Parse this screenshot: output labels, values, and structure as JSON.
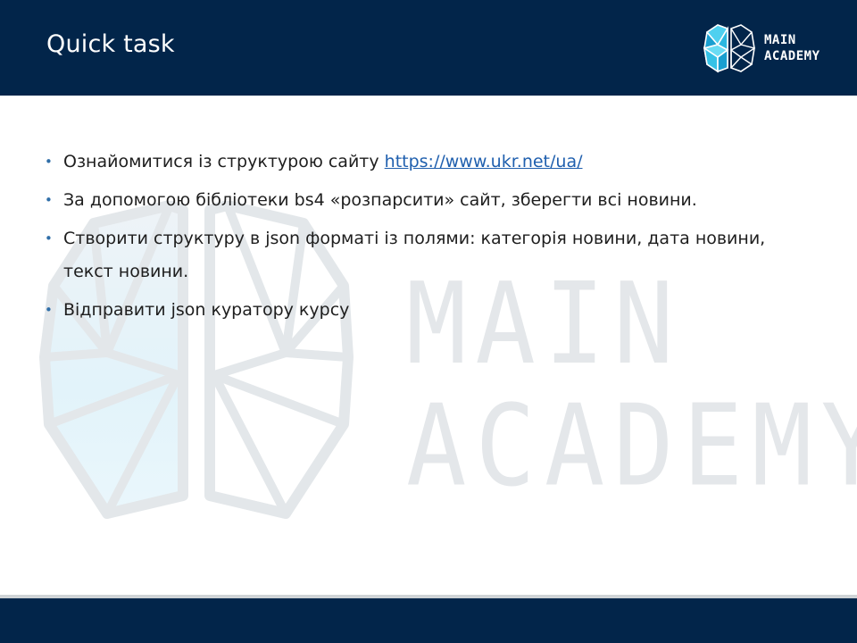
{
  "header": {
    "title": "Quick task",
    "logo_line1": "MAIN",
    "logo_line2": "ACADEMY",
    "background": "#02254a",
    "logo_accent": "#3ec6e8"
  },
  "watermark": {
    "line1": "MAIN",
    "line2": "ACADEMY"
  },
  "bullets": [
    {
      "text": "Ознайомитися  із структурою сайту ",
      "link": "https://www.ukr.net/ua/"
    },
    {
      "text": "За допомогою бібліотеки bs4 «розпарсити» сайт, зберегти всі новини."
    },
    {
      "text": "Створити структуру в json форматі із полями: категорія новини, дата новини, текст новини."
    },
    {
      "text": "Відправити json куратору курсу"
    }
  ],
  "colors": {
    "bullet": "#2f6ea8",
    "link": "#1f5fae",
    "footer": "#02254a"
  }
}
